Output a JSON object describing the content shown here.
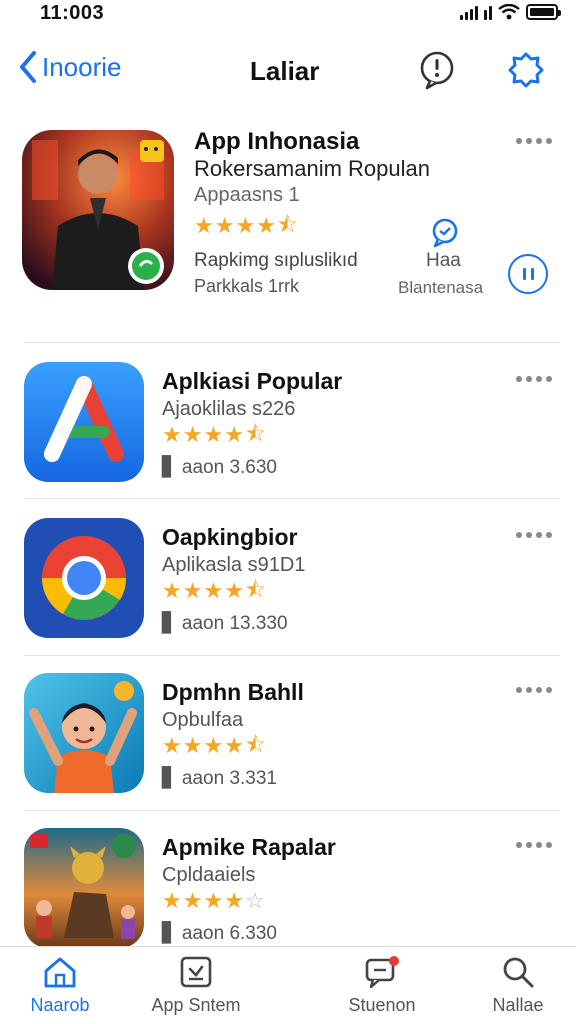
{
  "status_bar": {
    "time": "11:003"
  },
  "nav": {
    "back_label": "Inoorie",
    "title": "Laliar"
  },
  "featured": {
    "title": "App  Inhonasia",
    "subtitle": "Rokersamanim Ropulan",
    "category": "Appaasns 1",
    "rating": 4.5,
    "info_line1": "Rapkimg sıpluslikıd",
    "info_line2": "Parkkals    1rrk",
    "side_label": "Haa",
    "side_status": "Blantenasa"
  },
  "apps": [
    {
      "title": "Aplkiasi Popular",
      "subtitle": "Ajaoklilas s226",
      "rating": 4.5,
      "size": "aaon  3.630"
    },
    {
      "title": "Oapkingbior",
      "subtitle": "Aplikasla s91D1",
      "rating": 4.5,
      "size": "aaon  13.330"
    },
    {
      "title": "Dpmhn Bahll",
      "subtitle": "Opbulfaa",
      "rating": 4.5,
      "size": "aaon  3.331"
    },
    {
      "title": "Apmike Rapalar",
      "subtitle": "Cpldaaiels",
      "rating": 4.0,
      "size": "aaon  6.330"
    }
  ],
  "tabs": [
    {
      "label": "Naarob",
      "icon": "home-icon"
    },
    {
      "label": "App Sntem",
      "icon": "app-store-icon"
    },
    {
      "label": "Stuenon",
      "icon": "updates-icon"
    },
    {
      "label": "Nallae",
      "icon": "search-icon"
    }
  ],
  "colors": {
    "accent": "#1a73e8",
    "star": "#f5a623",
    "divider": "#e2e2e2"
  }
}
